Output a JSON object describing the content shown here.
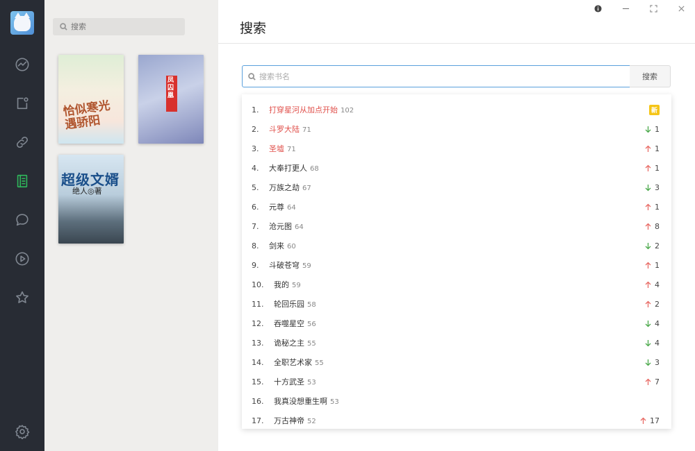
{
  "shelf": {
    "search_placeholder": "搜索"
  },
  "books": [
    {
      "title": "恰似寒光遇骄阳"
    },
    {
      "title": "凤囚凰"
    },
    {
      "title": "超级文婿",
      "author": "绝人◎著"
    }
  ],
  "header": {
    "title": "搜索"
  },
  "search": {
    "placeholder": "搜索书名",
    "button_label": "搜索"
  },
  "colors": {
    "accent": "#2fb45a",
    "hot": "#e0504b",
    "up": "#e86a64",
    "down": "#4aa84a",
    "new_badge": "#f5c518"
  },
  "ranking": [
    {
      "rank": "1.",
      "name": "打穿星河从加点开始",
      "count": "102",
      "hot": true,
      "trend": "new",
      "change": "新"
    },
    {
      "rank": "2.",
      "name": "斗罗大陆",
      "count": "71",
      "hot": true,
      "trend": "down",
      "change": "1"
    },
    {
      "rank": "3.",
      "name": "圣墟",
      "count": "71",
      "hot": true,
      "trend": "up",
      "change": "1"
    },
    {
      "rank": "4.",
      "name": "大奉打更人",
      "count": "68",
      "hot": false,
      "trend": "up",
      "change": "1"
    },
    {
      "rank": "5.",
      "name": "万族之劫",
      "count": "67",
      "hot": false,
      "trend": "down",
      "change": "3"
    },
    {
      "rank": "6.",
      "name": "元尊",
      "count": "64",
      "hot": false,
      "trend": "up",
      "change": "1"
    },
    {
      "rank": "7.",
      "name": "沧元图",
      "count": "64",
      "hot": false,
      "trend": "up",
      "change": "8"
    },
    {
      "rank": "8.",
      "name": "剑来",
      "count": "60",
      "hot": false,
      "trend": "down",
      "change": "2"
    },
    {
      "rank": "9.",
      "name": "斗破苍穹",
      "count": "59",
      "hot": false,
      "trend": "up",
      "change": "1"
    },
    {
      "rank": "10.",
      "name": "我的",
      "count": "59",
      "hot": false,
      "trend": "up",
      "change": "4"
    },
    {
      "rank": "11.",
      "name": "轮回乐园",
      "count": "58",
      "hot": false,
      "trend": "up",
      "change": "2"
    },
    {
      "rank": "12.",
      "name": "吞噬星空",
      "count": "56",
      "hot": false,
      "trend": "down",
      "change": "4"
    },
    {
      "rank": "13.",
      "name": "诡秘之主",
      "count": "55",
      "hot": false,
      "trend": "down",
      "change": "4"
    },
    {
      "rank": "14.",
      "name": "全职艺术家",
      "count": "55",
      "hot": false,
      "trend": "down",
      "change": "3"
    },
    {
      "rank": "15.",
      "name": "十方武圣",
      "count": "53",
      "hot": false,
      "trend": "up",
      "change": "7"
    },
    {
      "rank": "16.",
      "name": "我真没想重生啊",
      "count": "53",
      "hot": false,
      "trend": "none",
      "change": ""
    },
    {
      "rank": "17.",
      "name": "万古神帝",
      "count": "52",
      "hot": false,
      "trend": "up",
      "change": "17"
    }
  ]
}
